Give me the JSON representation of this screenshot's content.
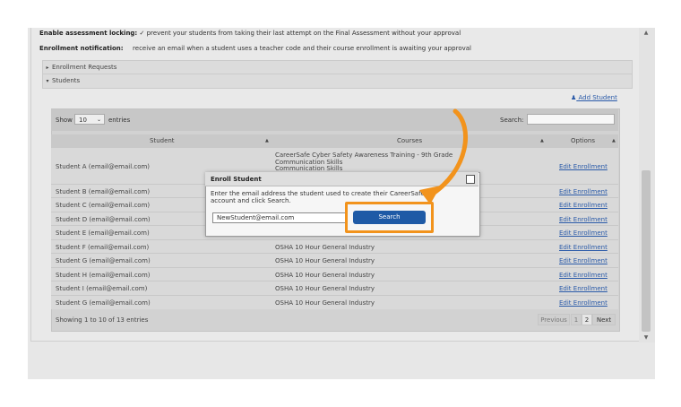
{
  "settings": {
    "locking_label": "Enable assessment locking:",
    "locking_check": "✓",
    "locking_text": "prevent your students from taking their last attempt on the Final Assessment without your approval",
    "notification_label": "Enrollment notification:",
    "notification_text": "receive an email when a student uses a teacher code and their course enrollment is awaiting your approval"
  },
  "sections": {
    "enrollment_requests": "Enrollment Requests",
    "students": "Students",
    "enrollment_arrow": "▸",
    "students_arrow": "▾"
  },
  "add_student_label": "Add Student",
  "table": {
    "show_label": "Show",
    "show_value": "10",
    "entries_label": "entries",
    "search_label": "Search:",
    "headers": [
      "Student",
      "Courses",
      "Options"
    ],
    "sort_icons": [
      "▲",
      "▲",
      "▲"
    ],
    "rows": [
      {
        "student": "Student A (email@email.com)",
        "course": "CareerSafe Cyber Safety Awareness Training - 9th Grade",
        "course2": "Communication Skills",
        "course3": "Communication Skills",
        "option": "Edit Enrollment"
      },
      {
        "student": "Student B (email@email.com)",
        "course": "",
        "option": "Edit Enrollment"
      },
      {
        "student": "Student C (email@email.com)",
        "course": "",
        "option": "Edit Enrollment"
      },
      {
        "student": "Student D (email@email.com)",
        "course": "",
        "option": "Edit Enrollment"
      },
      {
        "student": "Student E (email@email.com)",
        "course": "",
        "option": "Edit Enrollment"
      },
      {
        "student": "Student F (email@email.com)",
        "course": "OSHA 10 Hour General Industry",
        "option": "Edit Enrollment"
      },
      {
        "student": "Student G (email@email.com)",
        "course": "OSHA 10 Hour General Industry",
        "option": "Edit Enrollment"
      },
      {
        "student": "Student H (email@email.com)",
        "course": "OSHA 10 Hour General Industry",
        "option": "Edit Enrollment"
      },
      {
        "student": "Student I (email@email.com)",
        "course": "OSHA 10 Hour General Industry",
        "option": "Edit Enrollment"
      },
      {
        "student": "Student G (email@email.com)",
        "course": "OSHA 10 Hour General Industry",
        "option": "Edit Enrollment"
      }
    ],
    "footer_info": "Showing 1 to 10 of 13 entries",
    "pager": {
      "previous": "Previous",
      "page1": "1",
      "page2": "2",
      "next": "Next"
    }
  },
  "modal": {
    "title": "Enroll Student",
    "text": "Enter the email address the student used to create their CareerSafe account and click Search.",
    "input_value": "NewStudent@email.com",
    "search_button": "Search"
  },
  "colors": {
    "accent_orange": "#f2931c",
    "button_blue": "#1e5aa6",
    "link_blue": "#2a5aa8"
  }
}
